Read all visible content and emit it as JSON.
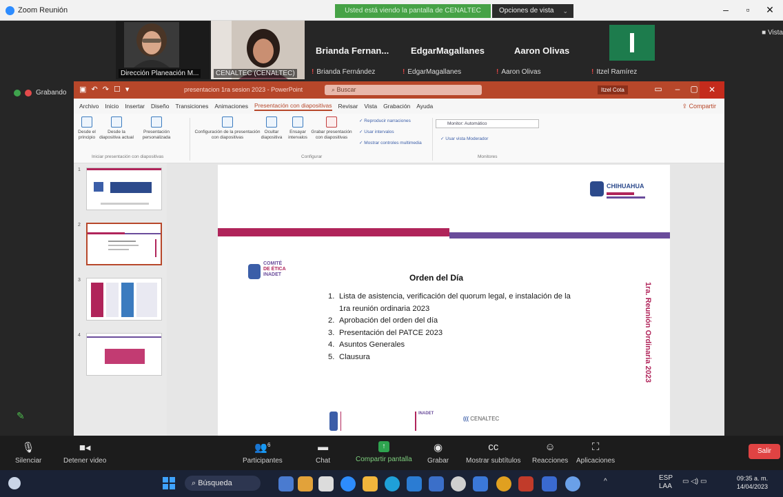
{
  "zoom": {
    "window_title": "Zoom Reunión",
    "share_banner": "Usted está viendo la pantalla de CENALTEC",
    "view_options": "Opciones de vista",
    "vista": "Vista",
    "recording_label": "Grabando",
    "participants": [
      {
        "name": "Dirección Planeación M...",
        "type": "video"
      },
      {
        "name": "CENALTEC (CENALTEC)",
        "type": "video"
      },
      {
        "display_name": "Brianda  Fernan...",
        "name": "Brianda Fernández",
        "type": "name"
      },
      {
        "display_name": "EdgarMagallanes",
        "name": "EdgarMagallanes",
        "type": "name"
      },
      {
        "display_name": "Aaron Olivas",
        "name": "Aaron Olivas",
        "type": "name"
      },
      {
        "name": "Itzel Ramírez",
        "type": "initial",
        "initial": "I"
      }
    ],
    "toolbar": [
      {
        "label": "Silenciar",
        "icon": "microphone-icon"
      },
      {
        "label": "Detener video",
        "icon": "video-camera-icon"
      },
      {
        "label": "Participantes",
        "icon": "participants-icon",
        "count": "6"
      },
      {
        "label": "Chat",
        "icon": "chat-icon"
      },
      {
        "label": "Compartir pantalla",
        "icon": "share-screen-icon"
      },
      {
        "label": "Grabar",
        "icon": "record-icon"
      },
      {
        "label": "Mostrar subtítulos",
        "icon": "captions-icon"
      },
      {
        "label": "Reacciones",
        "icon": "reactions-icon"
      },
      {
        "label": "Aplicaciones",
        "icon": "apps-icon"
      }
    ],
    "leave_label": "Salir"
  },
  "ppt": {
    "doc_title": "presentacion 1ra sesion 2023 - PowerPoint",
    "search_placeholder": "Buscar",
    "user": "Itzel Cota",
    "menu": [
      "Archivo",
      "Inicio",
      "Insertar",
      "Diseño",
      "Transiciones",
      "Animaciones",
      "Presentación con diapositivas",
      "Revisar",
      "Vista",
      "Grabación",
      "Ayuda"
    ],
    "active_menu": "Presentación con diapositivas",
    "share": "Compartir",
    "ribbon": {
      "buttons": [
        "Desde el principio",
        "Desde la diapositiva actual",
        "Presentación personalizada",
        "Configuración de la presentación con diapositivas",
        "Ocultar diapositiva",
        "Ensayar intervalos",
        "Grabar presentación con diapositivas"
      ],
      "checks": [
        "Reproducir narraciones",
        "Usar intervalos",
        "Mostrar controles multimedia",
        "Usar vista Moderador"
      ],
      "monitor_label": "Monitor: Automático",
      "groups": [
        "Iniciar presentación con diapositivas",
        "Configurar",
        "Monitores"
      ]
    },
    "thumbnails": [
      "1",
      "2",
      "3",
      "4"
    ],
    "slide": {
      "logo_text": "CHIHUAHUA",
      "comite": [
        "COMITÉ",
        "DE ÉTICA",
        "INADET"
      ],
      "heading": "Orden del Día",
      "agenda": [
        "Lista de asistencia, verificación del quorum legal, e instalación de la 1ra reunión ordinaria 2023",
        "Aprobación del orden del día",
        "Presentación del PATCE 2023",
        "Asuntos Generales",
        "Clausura"
      ],
      "vertical": "1ra. Reunión Ordinaria 2023",
      "footer_logos": [
        "INADET",
        "CENALTEC"
      ]
    }
  },
  "taskbar": {
    "search": "Búsqueda",
    "lang": "ESP",
    "lang2": "LAA",
    "time": "09:35 a. m.",
    "date": "14/04/2023"
  }
}
